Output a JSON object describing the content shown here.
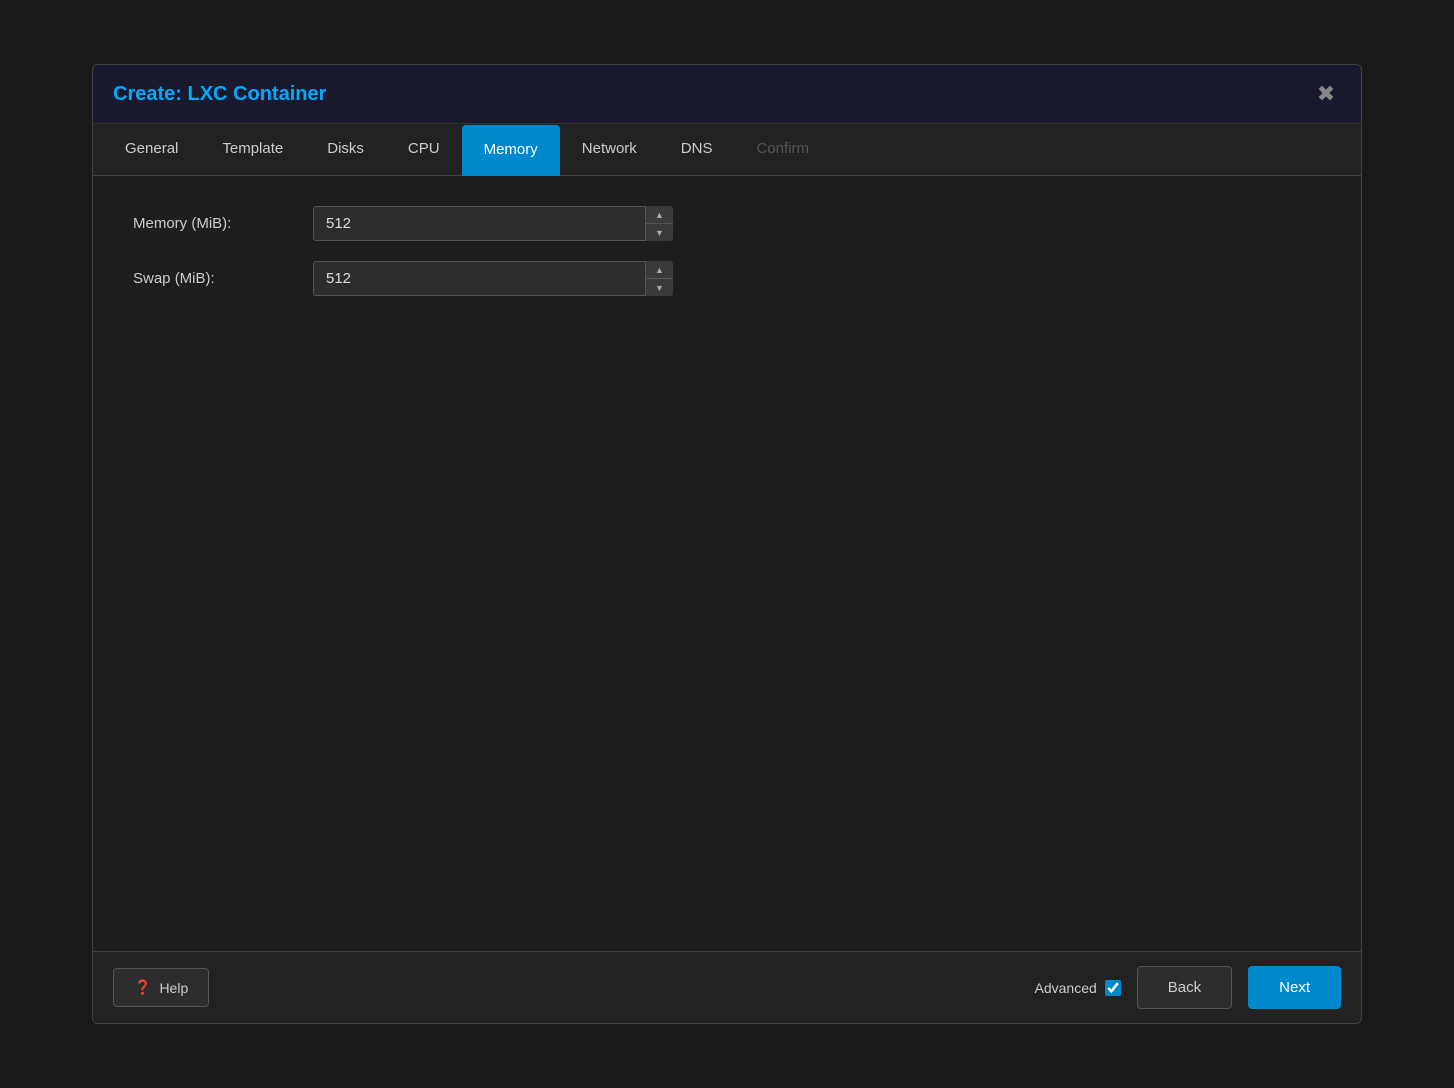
{
  "dialog": {
    "title": "Create: LXC Container"
  },
  "tabs": [
    {
      "id": "general",
      "label": "General",
      "active": false,
      "disabled": false
    },
    {
      "id": "template",
      "label": "Template",
      "active": false,
      "disabled": false
    },
    {
      "id": "disks",
      "label": "Disks",
      "active": false,
      "disabled": false
    },
    {
      "id": "cpu",
      "label": "CPU",
      "active": false,
      "disabled": false
    },
    {
      "id": "memory",
      "label": "Memory",
      "active": true,
      "disabled": false
    },
    {
      "id": "network",
      "label": "Network",
      "active": false,
      "disabled": false
    },
    {
      "id": "dns",
      "label": "DNS",
      "active": false,
      "disabled": false
    },
    {
      "id": "confirm",
      "label": "Confirm",
      "active": false,
      "disabled": true
    }
  ],
  "form": {
    "memory_label": "Memory (MiB):",
    "memory_value": "512",
    "swap_label": "Swap (MiB):",
    "swap_value": "512"
  },
  "footer": {
    "help_label": "Help",
    "advanced_label": "Advanced",
    "back_label": "Back",
    "next_label": "Next"
  }
}
